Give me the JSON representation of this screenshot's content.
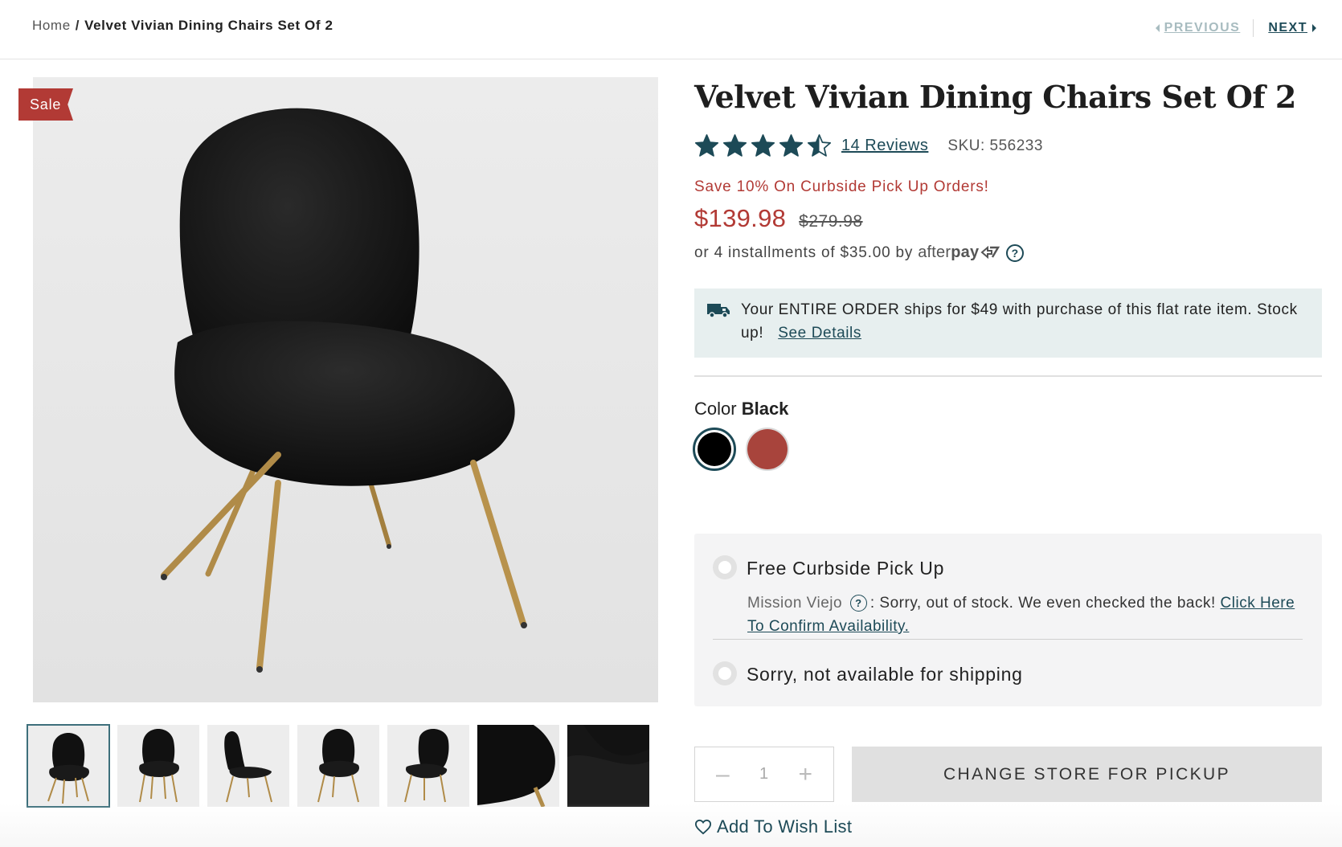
{
  "breadcrumb": {
    "home": "Home",
    "separator": "/",
    "current": "Velvet Vivian Dining Chairs Set Of 2"
  },
  "pager": {
    "previous": "PREVIOUS",
    "next": "NEXT"
  },
  "badge": {
    "sale": "Sale"
  },
  "product": {
    "title": "Velvet Vivian Dining Chairs Set Of 2",
    "rating": 4.5,
    "rating_max": 5,
    "reviews": "14 Reviews",
    "sku": "SKU: 556233",
    "promo": "Save 10% On Curbside Pick Up Orders!",
    "price_sale": "$139.98",
    "price_original": "$279.98",
    "installments": "or 4 installments of $35.00 by",
    "afterpay_light": "after",
    "afterpay_bold": "pay"
  },
  "shipping": {
    "message": "Your ENTIRE ORDER ships for $49 with purchase of this flat rate item. Stock up!",
    "link": "See Details"
  },
  "color": {
    "label": "Color",
    "selected": "Black",
    "swatches": [
      {
        "name": "Black",
        "hex": "#000000"
      },
      {
        "name": "Red",
        "hex": "#a8443c"
      }
    ]
  },
  "fulfillment": {
    "pickup_label": "Free Curbside Pick Up",
    "store_name": "Mission Viejo",
    "store_message": ": Sorry, out of stock. We even checked the back!",
    "store_link": "Click Here To Confirm Availability.",
    "shipping_label": "Sorry, not available for shipping"
  },
  "cart": {
    "quantity": "1",
    "pickup_button": "CHANGE STORE FOR PICKUP",
    "wishlist": "Add To Wish List"
  },
  "thumbnails": [
    {
      "name": "front-view"
    },
    {
      "name": "front-view-2"
    },
    {
      "name": "side-view"
    },
    {
      "name": "front-view-3"
    },
    {
      "name": "angle-view"
    },
    {
      "name": "velvet-closeup"
    },
    {
      "name": "fabric-detail"
    }
  ],
  "colors": {
    "accent": "#1d4a57",
    "sale": "#b23a35",
    "ship_bg": "#e7efef"
  }
}
